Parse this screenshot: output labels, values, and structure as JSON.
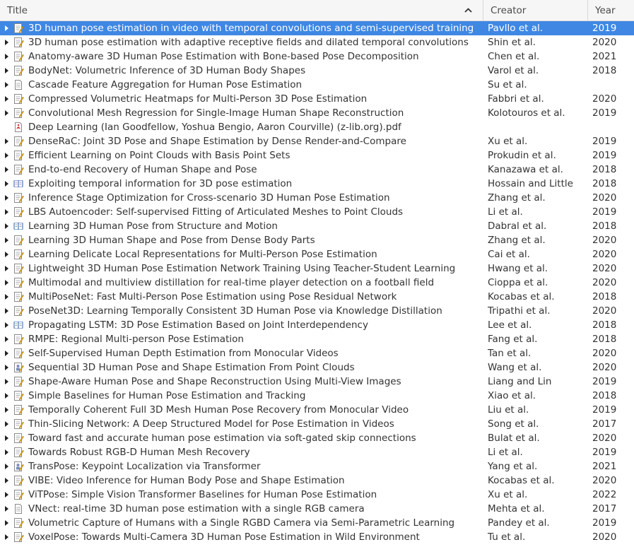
{
  "header": {
    "title": "Title",
    "creator": "Creator",
    "year": "Year"
  },
  "rows": [
    {
      "title": "3D human pose estimation in video with temporal convolutions and semi-supervised training",
      "creator": "Pavllo et al.",
      "year": "2019",
      "icon": "journal-article-icon",
      "expandable": true,
      "selected": true
    },
    {
      "title": "3D human pose estimation with adaptive receptive fields and dilated temporal convolutions",
      "creator": "Shin et al.",
      "year": "2020",
      "icon": "journal-article-icon",
      "expandable": true
    },
    {
      "title": "Anatomy-aware 3D Human Pose Estimation with Bone-based Pose Decomposition",
      "creator": "Chen et al.",
      "year": "2021",
      "icon": "journal-article-icon",
      "expandable": true
    },
    {
      "title": "BodyNet: Volumetric Inference of 3D Human Body Shapes",
      "creator": "Varol et al.",
      "year": "2018",
      "icon": "journal-article-icon",
      "expandable": true
    },
    {
      "title": "Cascade Feature Aggregation for Human Pose Estimation",
      "creator": "Su et al.",
      "year": "",
      "icon": "document-icon",
      "expandable": true
    },
    {
      "title": "Compressed Volumetric Heatmaps for Multi-Person 3D Pose Estimation",
      "creator": "Fabbri et al.",
      "year": "2020",
      "icon": "journal-article-icon",
      "expandable": true
    },
    {
      "title": "Convolutional Mesh Regression for Single-Image Human Shape Reconstruction",
      "creator": "Kolotouros et al.",
      "year": "2019",
      "icon": "journal-article-icon",
      "expandable": true
    },
    {
      "title": "Deep Learning (Ian Goodfellow, Yoshua Bengio, Aaron Courville) (z-lib.org).pdf",
      "creator": "",
      "year": "",
      "icon": "pdf-icon",
      "expandable": false
    },
    {
      "title": "DenseRaC: Joint 3D Pose and Shape Estimation by Dense Render-and-Compare",
      "creator": "Xu et al.",
      "year": "2019",
      "icon": "journal-article-icon",
      "expandable": true
    },
    {
      "title": "Efficient Learning on Point Clouds with Basis Point Sets",
      "creator": "Prokudin et al.",
      "year": "2019",
      "icon": "journal-article-icon",
      "expandable": true
    },
    {
      "title": "End-to-end Recovery of Human Shape and Pose",
      "creator": "Kanazawa et al.",
      "year": "2018",
      "icon": "journal-article-icon",
      "expandable": true
    },
    {
      "title": "Exploiting temporal information for 3D pose estimation",
      "creator": "Hossain and Little",
      "year": "2018",
      "icon": "book-icon",
      "expandable": true
    },
    {
      "title": "Inference Stage Optimization for Cross-scenario 3D Human Pose Estimation",
      "creator": "Zhang et al.",
      "year": "2020",
      "icon": "journal-article-icon",
      "expandable": true
    },
    {
      "title": "LBS Autoencoder: Self-supervised Fitting of Articulated Meshes to Point Clouds",
      "creator": "Li et al.",
      "year": "2019",
      "icon": "journal-article-icon",
      "expandable": true
    },
    {
      "title": "Learning 3D Human Pose from Structure and Motion",
      "creator": "Dabral et al.",
      "year": "2018",
      "icon": "book-icon",
      "expandable": true
    },
    {
      "title": "Learning 3D Human Shape and Pose from Dense Body Parts",
      "creator": "Zhang et al.",
      "year": "2020",
      "icon": "journal-article-icon",
      "expandable": true
    },
    {
      "title": "Learning Delicate Local Representations for Multi-Person Pose Estimation",
      "creator": "Cai et al.",
      "year": "2020",
      "icon": "journal-article-icon",
      "expandable": true
    },
    {
      "title": "Lightweight 3D Human Pose Estimation Network Training Using Teacher-Student Learning",
      "creator": "Hwang et al.",
      "year": "2020",
      "icon": "journal-article-icon",
      "expandable": true
    },
    {
      "title": "Multimodal and multiview distillation for real-time player detection on a football field",
      "creator": "Cioppa et al.",
      "year": "2020",
      "icon": "journal-article-icon",
      "expandable": true
    },
    {
      "title": "MultiPoseNet: Fast Multi-Person Pose Estimation using Pose Residual Network",
      "creator": "Kocabas et al.",
      "year": "2018",
      "icon": "journal-article-icon",
      "expandable": true
    },
    {
      "title": "PoseNet3D: Learning Temporally Consistent 3D Human Pose via Knowledge Distillation",
      "creator": "Tripathi et al.",
      "year": "2020",
      "icon": "journal-article-icon",
      "expandable": true
    },
    {
      "title": "Propagating LSTM: 3D Pose Estimation Based on Joint Interdependency",
      "creator": "Lee et al.",
      "year": "2018",
      "icon": "book-icon",
      "expandable": true
    },
    {
      "title": "RMPE: Regional Multi-person Pose Estimation",
      "creator": "Fang et al.",
      "year": "2018",
      "icon": "journal-article-icon",
      "expandable": true
    },
    {
      "title": "Self-Supervised Human Depth Estimation from Monocular Videos",
      "creator": "Tan et al.",
      "year": "2020",
      "icon": "journal-article-icon",
      "expandable": true
    },
    {
      "title": "Sequential 3D Human Pose and Shape Estimation From Point Clouds",
      "creator": "Wang et al.",
      "year": "2020",
      "icon": "conference-paper-icon",
      "expandable": true
    },
    {
      "title": "Shape-Aware Human Pose and Shape Reconstruction Using Multi-View Images",
      "creator": "Liang and Lin",
      "year": "2019",
      "icon": "journal-article-icon",
      "expandable": true
    },
    {
      "title": "Simple Baselines for Human Pose Estimation and Tracking",
      "creator": "Xiao et al.",
      "year": "2018",
      "icon": "journal-article-icon",
      "expandable": true
    },
    {
      "title": "Temporally Coherent Full 3D Mesh Human Pose Recovery from Monocular Video",
      "creator": "Liu et al.",
      "year": "2019",
      "icon": "journal-article-icon",
      "expandable": true
    },
    {
      "title": "Thin-Slicing Network: A Deep Structured Model for Pose Estimation in Videos",
      "creator": "Song et al.",
      "year": "2017",
      "icon": "journal-article-icon",
      "expandable": true
    },
    {
      "title": "Toward fast and accurate human pose estimation via soft-gated skip connections",
      "creator": "Bulat et al.",
      "year": "2020",
      "icon": "journal-article-icon",
      "expandable": true
    },
    {
      "title": "Towards Robust RGB-D Human Mesh Recovery",
      "creator": "Li et al.",
      "year": "2019",
      "icon": "journal-article-icon",
      "expandable": true
    },
    {
      "title": "TransPose: Keypoint Localization via Transformer",
      "creator": "Yang et al.",
      "year": "2021",
      "icon": "conference-paper-icon",
      "expandable": true
    },
    {
      "title": "VIBE: Video Inference for Human Body Pose and Shape Estimation",
      "creator": "Kocabas et al.",
      "year": "2020",
      "icon": "journal-article-icon",
      "expandable": true
    },
    {
      "title": "ViTPose: Simple Vision Transformer Baselines for Human Pose Estimation",
      "creator": "Xu et al.",
      "year": "2022",
      "icon": "journal-article-icon",
      "expandable": true
    },
    {
      "title": "VNect: real-time 3D human pose estimation with a single RGB camera",
      "creator": "Mehta et al.",
      "year": "2017",
      "icon": "document-icon",
      "expandable": true
    },
    {
      "title": "Volumetric Capture of Humans with a Single RGBD Camera via Semi-Parametric Learning",
      "creator": "Pandey et al.",
      "year": "2019",
      "icon": "journal-article-icon",
      "expandable": true
    },
    {
      "title": "VoxelPose: Towards Multi-Camera 3D Human Pose Estimation in Wild Environment",
      "creator": "Tu et al.",
      "year": "2020",
      "icon": "journal-article-icon",
      "expandable": true
    }
  ]
}
